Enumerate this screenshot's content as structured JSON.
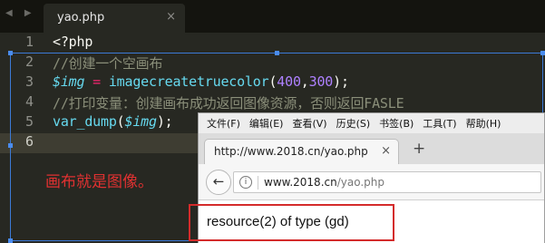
{
  "editor": {
    "nav_arrows": "◀ ▶",
    "tab": {
      "title": "yao.php",
      "close": "×"
    },
    "line_numbers": [
      "1",
      "2",
      "3",
      "4",
      "5",
      "6"
    ],
    "lines": {
      "l1": "<?php",
      "l2": "//创建一个空画布",
      "l3_var": "$img",
      "l3_eq": " = ",
      "l3_func": "imagecreatetruecolor",
      "l3_open": "(",
      "l3_a": "400",
      "l3_comma": ",",
      "l3_b": "300",
      "l3_close": ");",
      "l4": "//打印变量：创建画布成功返回图像资源，否则返回FASLE",
      "l5_func": "var_dump",
      "l5_open": "(",
      "l5_var": "$img",
      "l5_close": ");"
    },
    "annotation": "画布就是图像。",
    "colors": {
      "background": "#272822",
      "comment": "#8b8f7a",
      "variable": "#66d9ef",
      "operator": "#f92672",
      "number": "#ae81ff",
      "annotation": "#e03131"
    }
  },
  "browser": {
    "menu": [
      "文件(F)",
      "编辑(E)",
      "查看(V)",
      "历史(S)",
      "书签(B)",
      "工具(T)",
      "帮助(H)"
    ],
    "tab": {
      "title": "http://www.2018.cn/yao.php",
      "close": "×"
    },
    "new_tab": "+",
    "url": {
      "domain": "www.2018.cn",
      "path": "/yao.php"
    },
    "output": "resource(2) of type (gd)",
    "highlight_color": "#d42b2b"
  }
}
